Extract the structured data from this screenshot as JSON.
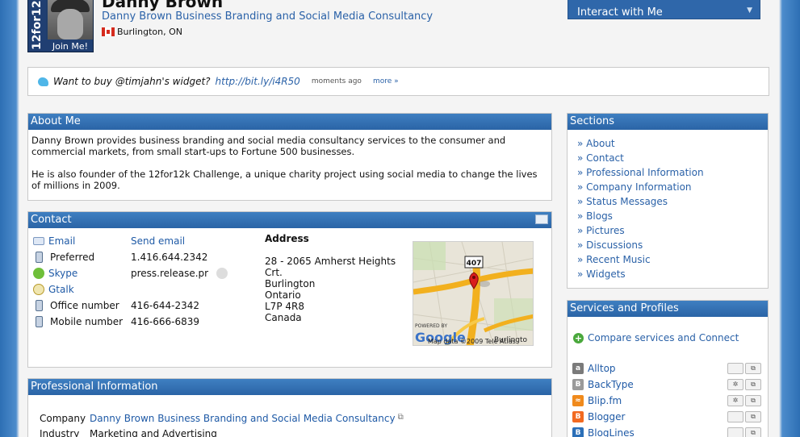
{
  "profile": {
    "name": "Danny Brown",
    "company_link": "Danny Brown Business Branding and Social Media Consultancy",
    "location": "Burlington, ON",
    "avatar_side_text": "12for12",
    "join_label": "Join Me!"
  },
  "interact": {
    "label": "Interact with Me"
  },
  "status": {
    "text": "Want to buy @timjahn's widget?",
    "link": "http://bit.ly/i4R50",
    "time": "moments ago",
    "more": "more »"
  },
  "about": {
    "title": "About Me",
    "para1": "Danny Brown provides business branding and social media consultancy services to the consumer and commercial markets, from small start-ups to Fortune 500 businesses.",
    "para2": "He is also founder of the 12for12k Challenge, a unique charity project using social media to change the lives of millions in 2009."
  },
  "contact": {
    "title": "Contact",
    "rows": [
      {
        "label": "Email",
        "value": "Send email"
      },
      {
        "label": "Preferred",
        "value": "1.416.644.2342"
      },
      {
        "label": "Skype",
        "value": "press.release.pr"
      },
      {
        "label": "Gtalk",
        "value": ""
      },
      {
        "label": "Office number",
        "value": "416-644-2342"
      },
      {
        "label": "Mobile number",
        "value": "416-666-6839"
      }
    ],
    "address_title": "Address",
    "address_lines": [
      "28 - 2065 Amherst Heights",
      "Crt.",
      "Burlington",
      "Ontario",
      "L7P 4R8",
      "Canada"
    ],
    "map": {
      "highway": "407",
      "powered": "POWERED BY",
      "brand": "Google",
      "copyright": "Map data ©2009 Tele Atlas",
      "city": "Burlingto"
    }
  },
  "professional": {
    "title": "Professional Information",
    "company_label": "Company",
    "company_value": "Danny Brown Business Branding and Social Media Consultancy",
    "industry_label": "Industry",
    "industry_value": "Marketing and Advertising"
  },
  "sections": {
    "title": "Sections",
    "items": [
      "» About",
      "» Contact",
      "» Professional Information",
      "» Company Information",
      "» Status Messages",
      "» Blogs",
      "» Pictures",
      "» Discussions",
      "» Recent Music",
      "» Widgets"
    ]
  },
  "services": {
    "title": "Services and Profiles",
    "compare": "Compare services and Connect",
    "items": [
      {
        "name": "Alltop",
        "glyph": "a",
        "color": "#7a7a7a"
      },
      {
        "name": "BackType",
        "glyph": "B",
        "color": "#9a9a9a"
      },
      {
        "name": "Blip.fm",
        "glyph": "≈",
        "color": "#f08a1c"
      },
      {
        "name": "Blogger",
        "glyph": "B",
        "color": "#f26a21"
      },
      {
        "name": "BlogLines",
        "glyph": "B",
        "color": "#2b6fb8"
      }
    ]
  }
}
